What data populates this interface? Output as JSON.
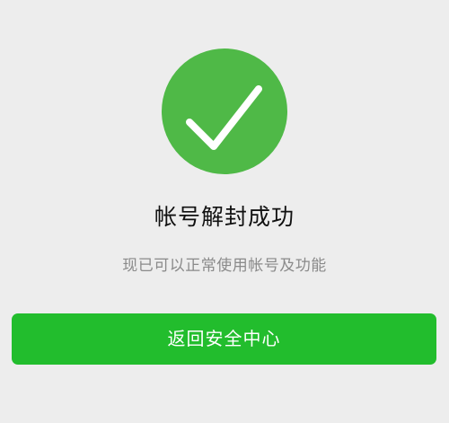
{
  "status": {
    "title": "帐号解封成功",
    "subtitle": "现已可以正常使用帐号及功能",
    "icon": "success-check-icon"
  },
  "actions": {
    "back_button_label": "返回安全中心"
  },
  "colors": {
    "background": "#ededed",
    "success_green": "#4fb947",
    "button_green": "#22bd2d",
    "title_text": "#111111",
    "subtitle_text": "#8a8a8a",
    "button_text": "#ffffff"
  }
}
